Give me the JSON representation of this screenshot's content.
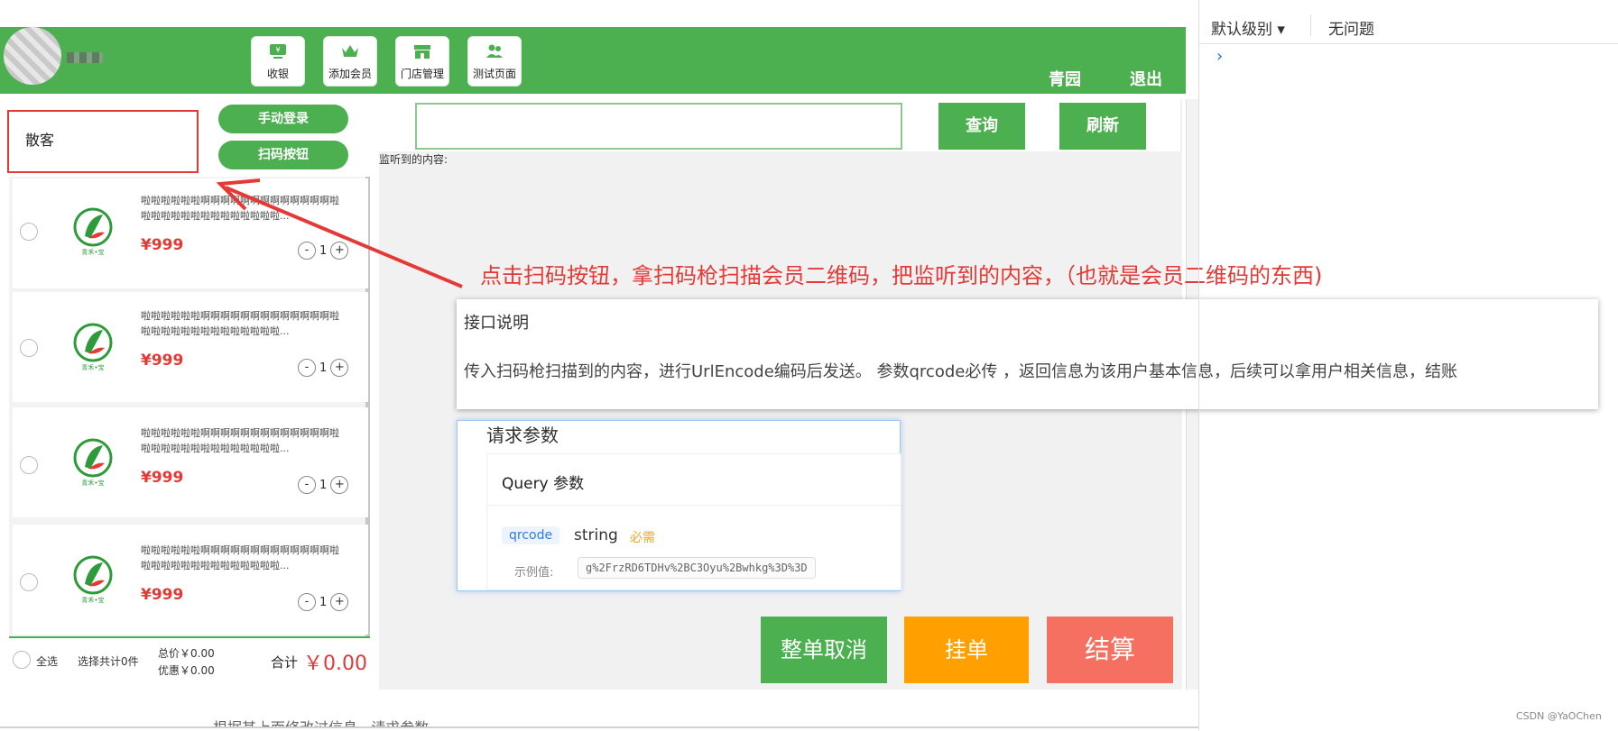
{
  "header": {
    "nav": [
      {
        "label": "收银",
        "icon": "cash-register-icon"
      },
      {
        "label": "添加会员",
        "icon": "crown-icon"
      },
      {
        "label": "门店管理",
        "icon": "store-icon"
      },
      {
        "label": "测试页面",
        "icon": "users-icon"
      }
    ],
    "store": "青园",
    "logout": "退出"
  },
  "member": {
    "name": "散客",
    "manual_login": "手动登录",
    "scan_button": "扫码按钮"
  },
  "products": [
    {
      "desc": "啦啦啦啦啦啦啊啊啊啊啊啊啊啊啊啊啊啊啊啦啦啦啦啦啦啦啦啦啦啦啦啦啦啦...",
      "price": "¥999",
      "qty": "1"
    },
    {
      "desc": "啦啦啦啦啦啦啊啊啊啊啊啊啊啊啊啊啊啊啊啦啦啦啦啦啦啦啦啦啦啦啦啦啦啦...",
      "price": "¥999",
      "qty": "1"
    },
    {
      "desc": "啦啦啦啦啦啦啊啊啊啊啊啊啊啊啊啊啊啊啊啦啦啦啦啦啦啦啦啦啦啦啦啦啦啦...",
      "price": "¥999",
      "qty": "1"
    },
    {
      "desc": "啦啦啦啦啦啦啊啊啊啊啊啊啊啊啊啊啊啊啊啦啦啦啦啦啦啦啦啦啦啦啦啦啦啦...",
      "price": "¥999",
      "qty": "1"
    }
  ],
  "stepper": {
    "minus": "-",
    "plus": "+"
  },
  "logo_caption": "青禾•宝",
  "footer": {
    "select_all": "全选",
    "selected_count": "选择共计0件",
    "total_price": "总价￥0.00",
    "discount": "优惠￥0.00",
    "sum_label": "合计",
    "sum_value": "￥0.00"
  },
  "search": {
    "value": "",
    "query_label": "查询",
    "refresh_label": "刷新",
    "listen_label": "监听到的内容:"
  },
  "annotation": "点击扫码按钮，拿扫码枪扫描会员二维码，把监听到的内容，（也就是会员二维码的东西)",
  "doc": {
    "title": "接口说明",
    "desc": "传入扫码枪扫描到的内容，进行UrlEncode编码后发送。 参数qrcode必传 ，返回信息为该用户基本信息，后续可以拿用户相关信息，结账",
    "params_title": "请求参数",
    "query_title": "Query 参数",
    "param_name": "qrcode",
    "param_type": "string",
    "param_required": "必需",
    "example_label": "示例值:",
    "example_value": "g%2FrzRD6TDHv%2BC3Oyu%2Bwhkg%3D%3D"
  },
  "actions": {
    "cancel": "整单取消",
    "hold": "挂单",
    "checkout": "结算"
  },
  "console": {
    "level": "默认级别 ▾",
    "issues": "无问题",
    "prompt": "›"
  },
  "watermark": "CSDN @YaOChen",
  "cut_text": "根据其上面修改过信息         ·  请求参数",
  "colors": {
    "primary": "#4caf50",
    "danger": "#e53935",
    "warning": "#ffa000",
    "checkout": "#f57060"
  }
}
